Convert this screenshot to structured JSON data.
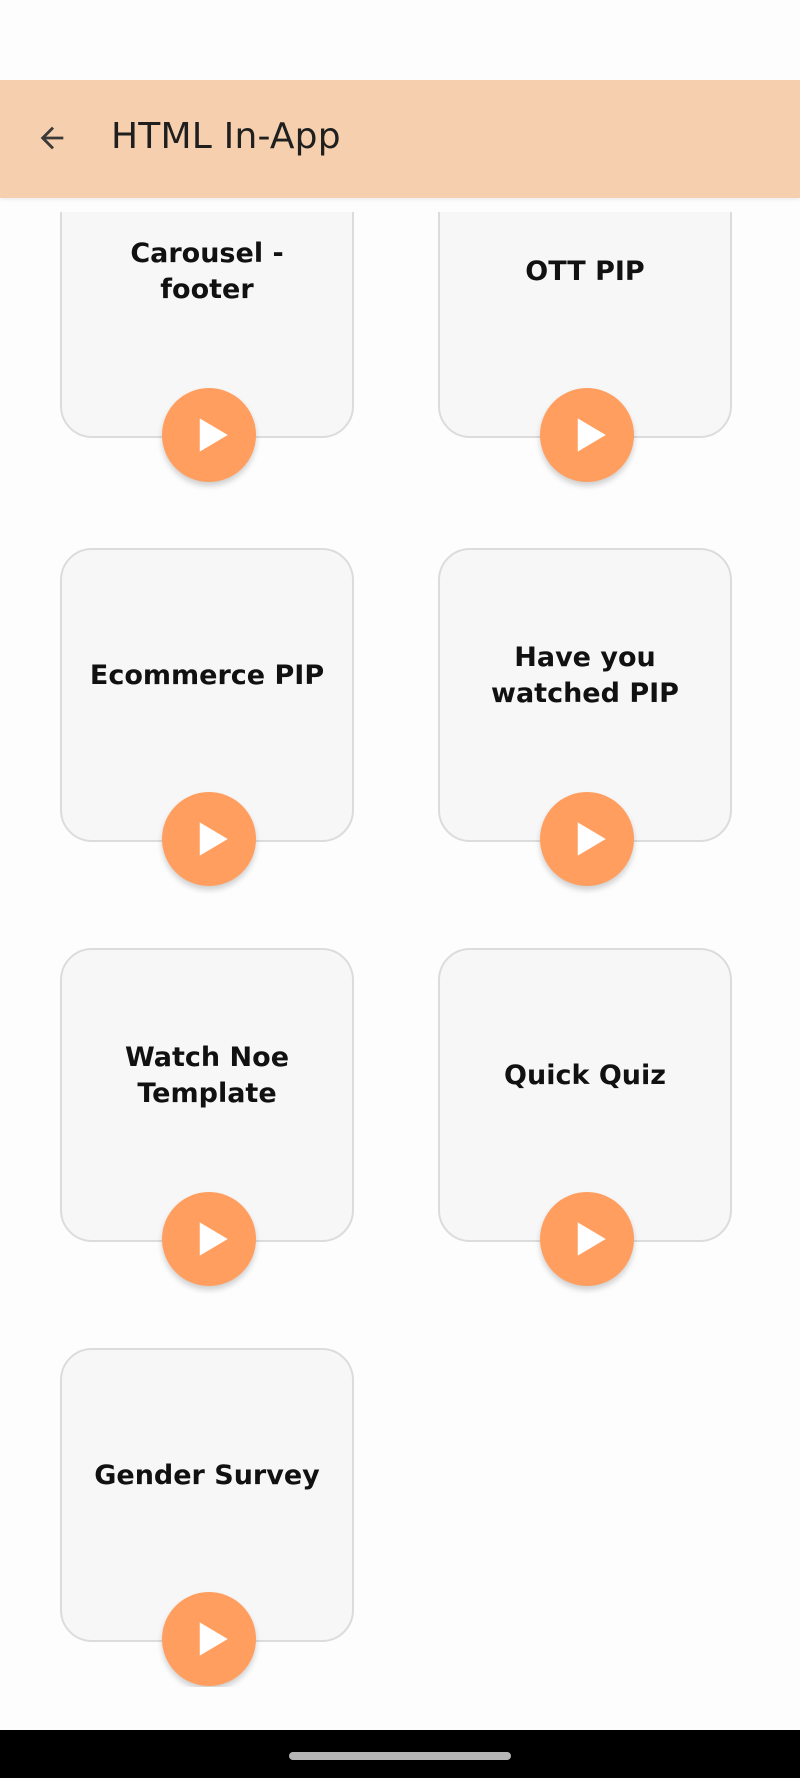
{
  "app_bar": {
    "title": "HTML In-App",
    "back_icon": "arrow-left-icon",
    "background": "#f6d0ae"
  },
  "cards": [
    {
      "title": "Carousel - footer"
    },
    {
      "title": "OTT PIP"
    },
    {
      "title": "Ecommerce PIP"
    },
    {
      "title": "Have you watched PIP"
    },
    {
      "title": "Watch Noe Template"
    },
    {
      "title": "Quick Quiz"
    },
    {
      "title": "Gender Survey"
    }
  ],
  "play_button": {
    "icon": "play-icon",
    "color": "#ff9e5e"
  }
}
